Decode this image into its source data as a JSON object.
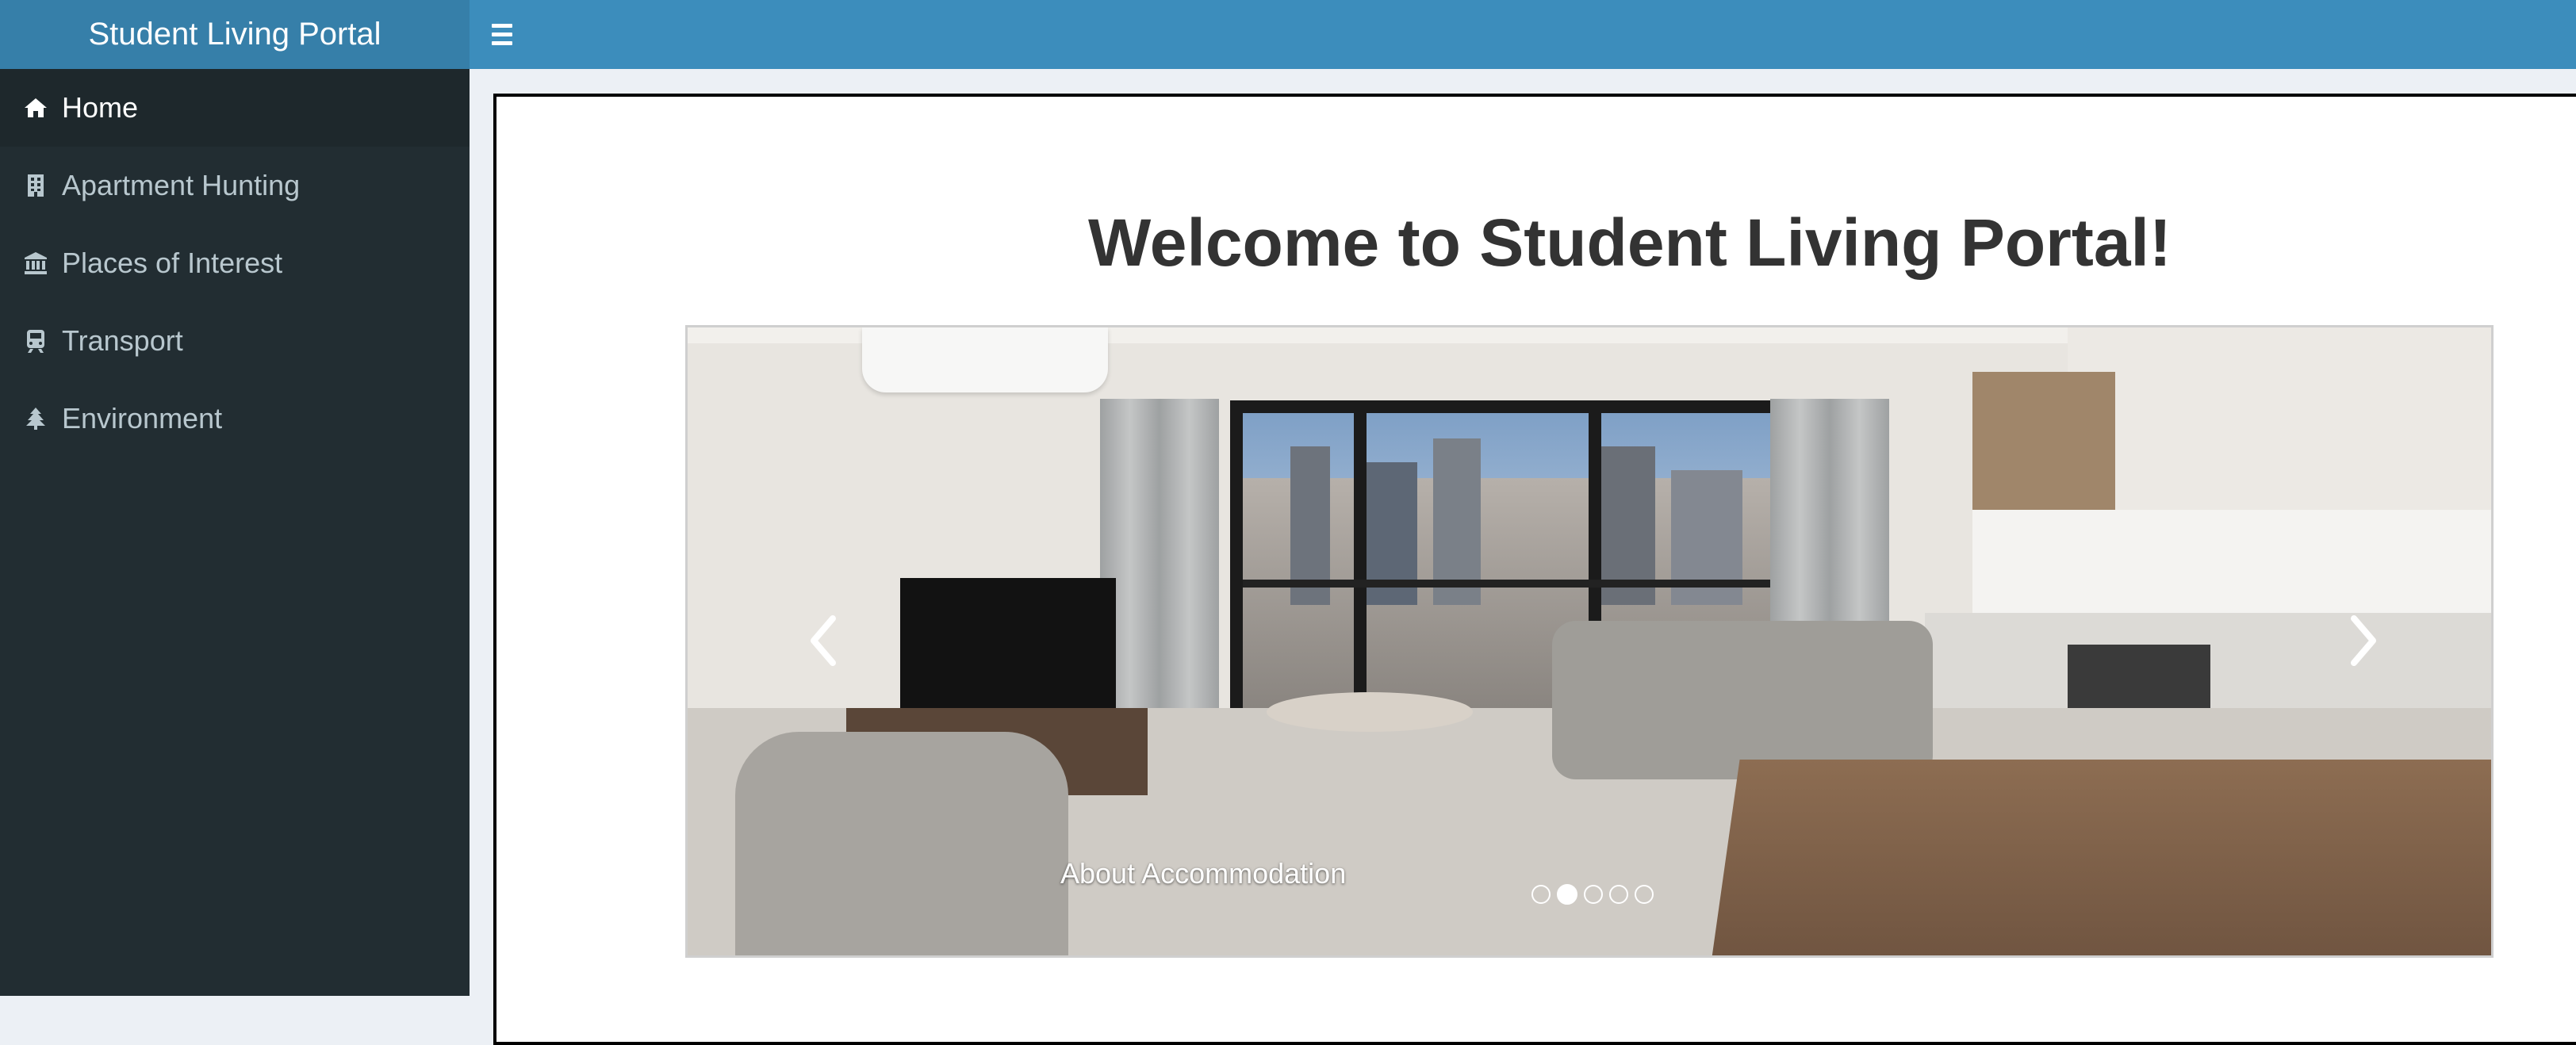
{
  "header": {
    "logo_text": "Student Living Portal",
    "toggle_icon": "hamburger-menu-icon",
    "header_color": "#3c8dbc",
    "logo_color": "#367fa9"
  },
  "sidebar": {
    "background": "#222d32",
    "items": [
      {
        "label": "Home",
        "icon": "home-icon",
        "active": true
      },
      {
        "label": "Apartment Hunting",
        "icon": "building-icon",
        "active": false
      },
      {
        "label": "Places of Interest",
        "icon": "institution-icon",
        "active": false
      },
      {
        "label": "Transport",
        "icon": "train-icon",
        "active": false
      },
      {
        "label": "Environment",
        "icon": "tree-icon",
        "active": false
      }
    ]
  },
  "main": {
    "title": "Welcome to Student Living Portal!",
    "carousel": {
      "caption": "About Accommodation",
      "slide_count": 5,
      "active_index": 1,
      "prev_icon": "chevron-left-icon",
      "next_icon": "chevron-right-icon"
    }
  }
}
